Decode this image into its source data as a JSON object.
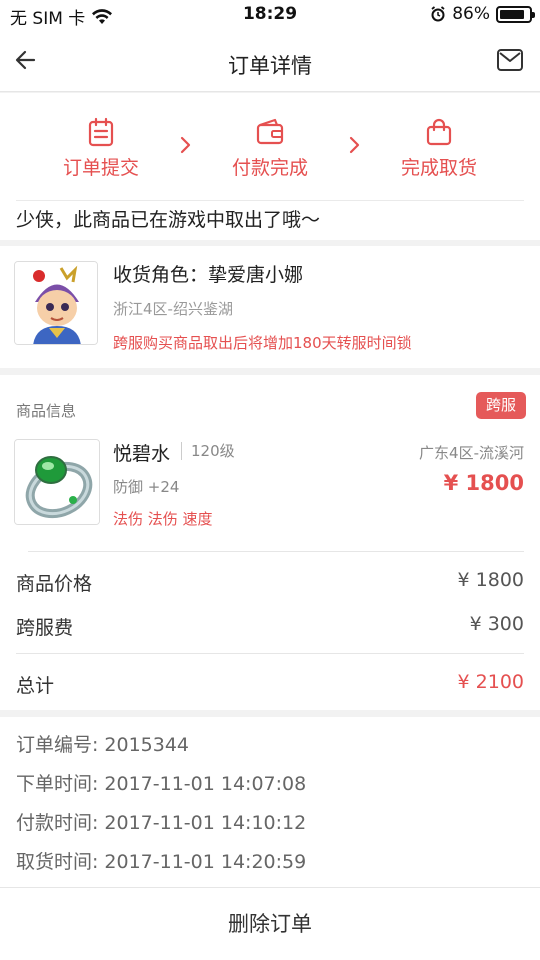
{
  "status_bar": {
    "carrier": "无 SIM 卡",
    "time": "18:29",
    "battery": "86%",
    "battery_level": 0.86
  },
  "nav": {
    "title": "订单详情",
    "back_icon": "back-arrow-icon",
    "mail_icon": "mail-icon"
  },
  "progress": {
    "steps": [
      {
        "label": "订单提交",
        "icon": "clipboard-icon"
      },
      {
        "label": "付款完成",
        "icon": "wallet-icon"
      },
      {
        "label": "完成取货",
        "icon": "shopping-bag-icon"
      }
    ],
    "accent": "#e55050"
  },
  "notice": "少侠，此商品已在游戏中取出了哦～",
  "role": {
    "label": "收货角色：",
    "name": "挚爱唐小娜",
    "server": "浙江4区-绍兴鉴湖",
    "warning": "跨服购买商品取出后将增加180天转服时间锁"
  },
  "goods": {
    "section_title": "商品信息",
    "badge": "跨服",
    "item": {
      "name": "悦碧水",
      "level": "120级",
      "server": "广东4区-流溪河",
      "stat": "防御 +24",
      "price": "¥ 1800",
      "attributes": "法伤 法伤 速度"
    },
    "price_label": "商品价格",
    "price_value": "¥ 1800",
    "fee_label": "跨服费",
    "fee_value": "¥ 300",
    "total_label": "总计",
    "total_value": "¥ 2100"
  },
  "order": {
    "number_label": "订单编号:",
    "number": "2015344",
    "placed_label": "下单时间:",
    "placed": "2017-11-01 14:07:08",
    "paid_label": "付款时间:",
    "paid": "2017-11-01 14:10:12",
    "picked_label": "取货时间:",
    "picked": "2017-11-01 14:20:59"
  },
  "footer": {
    "delete_label": "删除订单"
  }
}
